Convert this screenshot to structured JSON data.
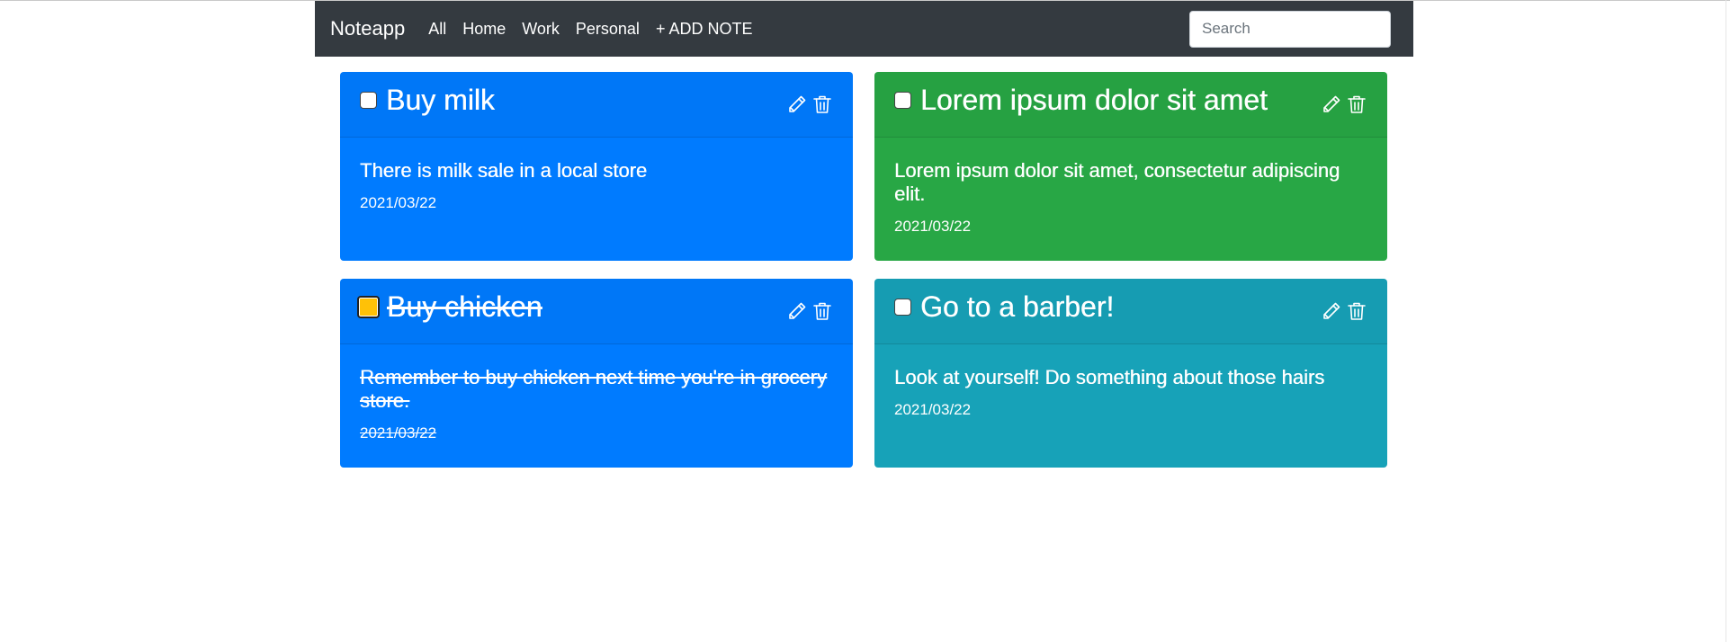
{
  "navbar": {
    "brand": "Noteapp",
    "links": [
      "All",
      "Home",
      "Work",
      "Personal",
      "+ ADD NOTE"
    ],
    "search_placeholder": "Search"
  },
  "notes": [
    {
      "title": "Buy milk",
      "body": "There is milk sale in a local store",
      "date": "2021/03/22",
      "color": "#007bff",
      "done": false
    },
    {
      "title": "Lorem ipsum dolor sit amet",
      "body": "Lorem ipsum dolor sit amet, consectetur adipiscing elit.",
      "date": "2021/03/22",
      "color": "#28a745",
      "done": false
    },
    {
      "title": "Buy chicken",
      "body": "Remember to buy chicken next time you're in grocery store.",
      "date": "2021/03/22",
      "color": "#007bff",
      "done": true
    },
    {
      "title": "Go to a barber!",
      "body": "Look at yourself! Do something about those hairs",
      "date": "2021/03/22",
      "color": "#17a2b8",
      "done": false
    }
  ],
  "icons": {
    "edit": "pencil-icon",
    "delete": "trash-icon",
    "checkbox": "checkbox"
  }
}
